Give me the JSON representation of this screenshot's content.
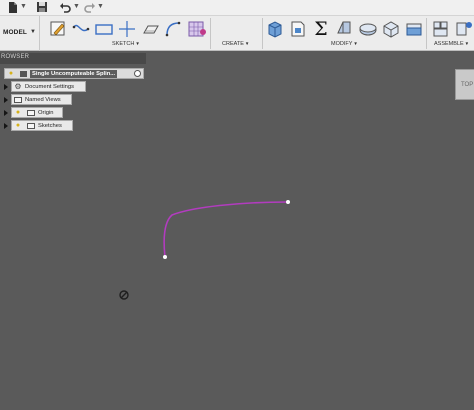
{
  "quick_access": {
    "items": [
      "file-menu-icon",
      "save-icon",
      "undo-icon",
      "redo-icon"
    ]
  },
  "toolbar": {
    "workspace": "MODEL",
    "groups": [
      {
        "label": "SKETCH",
        "tools": [
          "create-sketch-icon",
          "spline-icon",
          "rectangle-icon",
          "line-icon",
          "sketch-plane-icon",
          "fit-point-spline-icon",
          "sketch-grid-icon"
        ]
      },
      {
        "label": "CREATE",
        "tools": [
          "extrude-icon",
          "sheet-icon",
          "sum-icon"
        ]
      },
      {
        "label": "MODIFY",
        "tools": [
          "press-pull-icon",
          "fillet-icon",
          "shell-icon",
          "combine-icon"
        ]
      },
      {
        "label": "ASSEMBLE",
        "tools": [
          "new-component-icon",
          "joint-icon"
        ]
      }
    ],
    "sum_symbol": "Σ"
  },
  "browser": {
    "header": "ROWSER",
    "root": "Single Uncomputeable Splin...",
    "nodes": [
      {
        "label": "Document Settings",
        "icon": "gear-icon"
      },
      {
        "label": "Named Views",
        "icon": "folder-icon"
      },
      {
        "label": "Origin",
        "icon": "folder-icon"
      },
      {
        "label": "Sketches",
        "icon": "folder-icon"
      }
    ]
  },
  "viewcube": {
    "label": "TOP"
  },
  "sketch": {
    "curve_color": "#b23cbf",
    "point_color": "#ffffff",
    "background": "#5a5a5a"
  }
}
